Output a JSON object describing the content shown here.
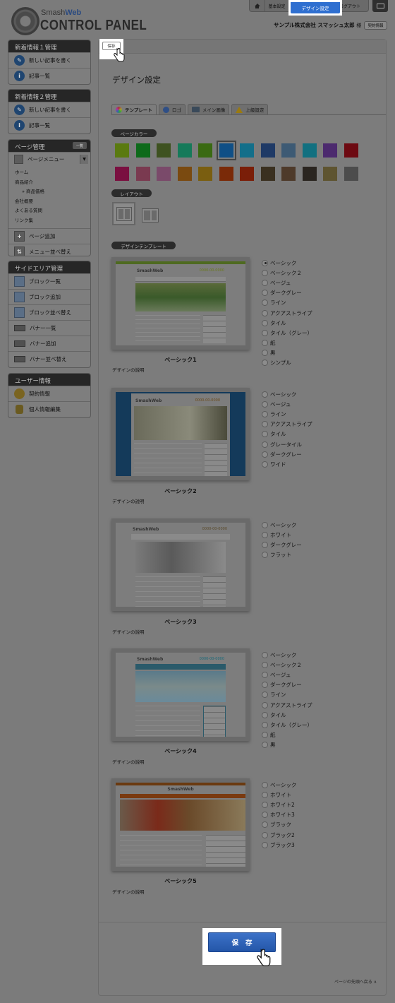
{
  "header": {
    "logo_small": "Smash",
    "logo_small_brand": "Web",
    "logo_big": "CONTROL PANEL",
    "nav": {
      "basic": "基本設定",
      "design": "デザイン設定",
      "logout": "ログアウト"
    },
    "company": "サンプル株式会社 スマッシュ太郎",
    "honorific": "様",
    "contract_button": "契約情報"
  },
  "sidebar": {
    "news1": {
      "title": "新着情報１管理",
      "items": [
        "新しい記事を書く",
        "記事一覧"
      ]
    },
    "news2": {
      "title": "新着情報２管理",
      "items": [
        "新しい記事を書く",
        "記事一覧"
      ]
    },
    "pages": {
      "title": "ページ管理",
      "list_button": "一覧",
      "menu_label": "ページメニュー",
      "menu_items": [
        "ホーム",
        "商品紹介",
        "商品価格",
        "会社概要",
        "よくある質問",
        "リンク集"
      ],
      "actions": [
        "ページ追加",
        "メニュー並べ替え"
      ]
    },
    "side_area": {
      "title": "サイドエリア管理",
      "items": [
        "ブロック一覧",
        "ブロック追加",
        "ブロック並べ替え",
        "バナー一覧",
        "バナー追加",
        "バナー並べ替え"
      ]
    },
    "user": {
      "title": "ユーザー情報",
      "items": [
        "契約情報",
        "個人情報編集"
      ]
    }
  },
  "main": {
    "save_top": "保存",
    "page_title": "デザイン設定",
    "tabs": [
      "テンプレート",
      "ロゴ",
      "メイン画像",
      "上級設定"
    ],
    "page_color_label": "ページカラー",
    "swatches": [
      "#5a7a10",
      "#0d6a1a",
      "#3e5220",
      "#167a5a",
      "#3a6a12",
      "#0f4f86",
      "#136f8a",
      "#1f3a66",
      "#3d5a74",
      "#127080",
      "#4c2a6e",
      "#6d0a12",
      "#7a1040",
      "#7a3a50",
      "#7a4a6a",
      "#7a4a10",
      "#7a5e10",
      "#7a2a08",
      "#7a1e08",
      "#3a3020",
      "#4e3a2a",
      "#2a2520",
      "#5e5430",
      "#4c4c4c"
    ],
    "layout_label": "レイアウト",
    "design_template_label": "デザインテンプレート",
    "templates": [
      {
        "name": "ベーシック1",
        "desc": "デザインの説明",
        "variants": [
          "ベーシック",
          "ベーシック２",
          "ベージュ",
          "ダークグレー",
          "ライン",
          "アクアストライプ",
          "タイル",
          "タイル（グレー）",
          "紙",
          "黒",
          "シンプル"
        ],
        "checked": 0
      },
      {
        "name": "ベーシック2",
        "desc": "デザインの説明",
        "variants": [
          "ベーシック",
          "ベージュ",
          "ライン",
          "アクアストライプ",
          "タイル",
          "グレータイル",
          "ダークグレー",
          "ワイド"
        ]
      },
      {
        "name": "ベーシック3",
        "desc": "デザインの説明",
        "variants": [
          "ベーシック",
          "ホワイト",
          "ダークグレー",
          "フラット"
        ]
      },
      {
        "name": "ベーシック4",
        "desc": "デザインの説明",
        "variants": [
          "ベーシック",
          "ベーシック２",
          "ベージュ",
          "ダークグレー",
          "ライン",
          "アクアストライプ",
          "タイル",
          "タイル（グレー）",
          "紙",
          "黒"
        ]
      },
      {
        "name": "ベーシック5",
        "desc": "デザインの説明",
        "variants": [
          "ベーシック",
          "ホワイト",
          "ホワイト2",
          "ホワイト3",
          "ブラック",
          "ブラック2",
          "ブラック3"
        ]
      }
    ],
    "template_shot": {
      "brand": "SmashWeb",
      "phone": "0000-00-0000"
    },
    "save_bottom": "保存",
    "page_top": "ページの先頭へ戻る ∧"
  }
}
